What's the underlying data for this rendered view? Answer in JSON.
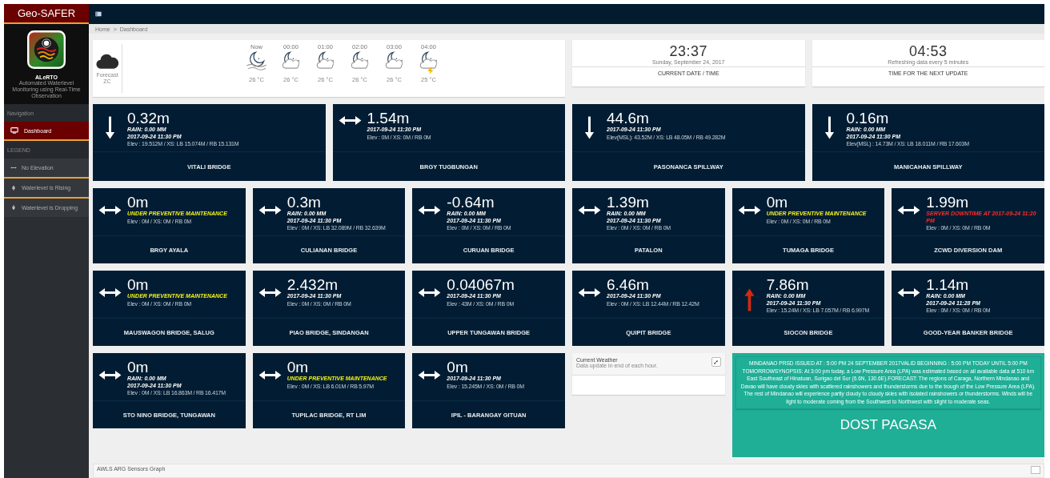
{
  "sidebar": {
    "title": "Geo-SAFER",
    "app_name": "ALeRTO",
    "app_subtitle": "Automated Waterlevel Monitoring using Real-Time Observation",
    "nav_header": "Navigation",
    "nav_items": [
      {
        "label": "Dashboard",
        "selected": true
      }
    ],
    "legend_header": "LEGEND",
    "legend_items": [
      {
        "kind": "steady",
        "label": "No Elevation"
      },
      {
        "kind": "rising",
        "label": "Waterlevel is Rising"
      },
      {
        "kind": "dropping",
        "label": "Waterlevel is Dropping"
      }
    ]
  },
  "breadcrumb": {
    "items": [
      "Home",
      "Dashboard"
    ],
    "separator": ">"
  },
  "forecast": {
    "label": "Forecast",
    "place": "ZC",
    "hours": [
      {
        "time": "Now",
        "kind": "moon-wind",
        "temp": "26 °C"
      },
      {
        "time": "00:00",
        "kind": "moon-cloud",
        "temp": "26 °C"
      },
      {
        "time": "01:00",
        "kind": "moon-cloud",
        "temp": "26 °C"
      },
      {
        "time": "02:00",
        "kind": "moon-cloud",
        "temp": "26 °C"
      },
      {
        "time": "03:00",
        "kind": "moon-cloud",
        "temp": "26 °C"
      },
      {
        "time": "04:00",
        "kind": "moon-storm",
        "temp": "25 °C"
      }
    ]
  },
  "clocks": [
    {
      "time": "23:37",
      "note": "Sunday, September 24, 2017",
      "label": "CURRENT DATE / TIME"
    },
    {
      "time": "04:53",
      "note": "Refreshing data every 5 minutes",
      "label": "TIME FOR THE NEXT UPDATE"
    }
  ],
  "featured_stations": [
    {
      "kind": "dropping",
      "level": "0.32m",
      "lines": [
        {
          "kind": "rain",
          "text": "RAIN: 0.00 MM"
        },
        {
          "kind": "date",
          "text": "2017-09-24 11:30 PM"
        },
        {
          "kind": "elev",
          "text": "Elev : 19.512M / XS: LB 15.074M / RB 15.131M"
        }
      ],
      "name": "VITALI BRIDGE"
    },
    {
      "kind": "steady",
      "level": "1.54m",
      "lines": [
        {
          "kind": "date",
          "text": "2017-09-24 11:30 PM"
        },
        {
          "kind": "elev",
          "text": "Elev : 0M / XS: 0M / RB 0M"
        }
      ],
      "name": "BRGY TUGBUNGAN"
    },
    {
      "kind": "dropping",
      "level": "44.6m",
      "lines": [
        {
          "kind": "date",
          "text": "2017-09-24 11:30 PM"
        },
        {
          "kind": "elev",
          "text": "Elev(MSL): 43.52M / XS: LB 48.05M / RB 49.282M"
        }
      ],
      "name": "PASONANCA SPILLWAY"
    },
    {
      "kind": "dropping",
      "level": "0.16m",
      "lines": [
        {
          "kind": "rain",
          "text": "RAIN: 0.00 MM"
        },
        {
          "kind": "date",
          "text": "2017-09-24 11:30 PM"
        },
        {
          "kind": "elev",
          "text": "Elev(MSL) : 14.73M / XS: LB 18.011M / RB 17.603M"
        }
      ],
      "name": "MANICAHAN SPILLWAY"
    }
  ],
  "stations": [
    {
      "kind": "steady",
      "level": "0m",
      "lines": [
        {
          "kind": "maintenance",
          "text": "UNDER PREVENTIVE MAINTENANCE"
        },
        {
          "kind": "elev",
          "text": "Elev : 0M / XS: 0M / RB 0M"
        }
      ],
      "name": "BRGY AYALA"
    },
    {
      "kind": "steady",
      "level": "0.3m",
      "lines": [
        {
          "kind": "rain",
          "text": "RAIN: 0.00 MM"
        },
        {
          "kind": "date",
          "text": "2017-09-24 11:30 PM"
        },
        {
          "kind": "elev",
          "text": "Elev : 0M / XS: LB 32.089M / RB 32.639M"
        }
      ],
      "name": "CULIANAN BRIDGE"
    },
    {
      "kind": "steady",
      "level": "-0.64m",
      "lines": [
        {
          "kind": "rain",
          "text": "RAIN: 0.00 MM"
        },
        {
          "kind": "date",
          "text": "2017-09-24 11:30 PM"
        },
        {
          "kind": "elev",
          "text": "Elev : 0M / XS: 0M / RB 0M"
        }
      ],
      "name": "CURUAN BRIDGE"
    },
    {
      "kind": "steady",
      "level": "1.39m",
      "lines": [
        {
          "kind": "rain",
          "text": "RAIN: 0.00 MM"
        },
        {
          "kind": "date",
          "text": "2017-09-24 11:30 PM"
        },
        {
          "kind": "elev",
          "text": "Elev : 0M / XS: 0M / RB 0M"
        }
      ],
      "name": "PATALON"
    },
    {
      "kind": "steady",
      "level": "0m",
      "lines": [
        {
          "kind": "maintenance",
          "text": "UNDER PREVENTIVE MAINTENANCE"
        },
        {
          "kind": "elev",
          "text": "Elev : 0M / XS: 0M / RB 0M"
        }
      ],
      "name": "TUMAGA BRIDGE"
    },
    {
      "kind": "steady",
      "level": "1.99m",
      "lines": [
        {
          "kind": "downtime",
          "text": "SERVER DOWNTIME AT 2017-09-24 11:20 PM"
        },
        {
          "kind": "elev",
          "text": "Elev : 0M / XS: 0M / RB 0M"
        }
      ],
      "name": "ZCWD DIVERSION DAM"
    },
    {
      "kind": "steady",
      "level": "0m",
      "lines": [
        {
          "kind": "maintenance",
          "text": "UNDER PREVENTIVE MAINTENANCE"
        },
        {
          "kind": "elev",
          "text": "Elev : 0M / XS: 0M / RB 0M"
        }
      ],
      "name": "MAUSWAGON BRIDGE, SALUG"
    },
    {
      "kind": "steady",
      "level": "2.432m",
      "lines": [
        {
          "kind": "date",
          "text": "2017-09-24 11:30 PM"
        },
        {
          "kind": "elev",
          "text": "Elev : 0M / XS: 0M / RB 0M"
        }
      ],
      "name": "PIAO BRIDGE, SINDANGAN"
    },
    {
      "kind": "steady",
      "level": "0.04067m",
      "lines": [
        {
          "kind": "date",
          "text": "2017-09-24 11:30 PM"
        },
        {
          "kind": "elev",
          "text": "Elev : 43M / XS: 0M / RB 0M"
        }
      ],
      "name": "UPPER TUNGAWAN BRIDGE"
    },
    {
      "kind": "steady",
      "level": "6.46m",
      "lines": [
        {
          "kind": "date",
          "text": "2017-09-24 11:30 PM"
        },
        {
          "kind": "elev",
          "text": "Elev : 0M / XS: LB 12.44M / RB 12.42M"
        }
      ],
      "name": "QUIPIT BRIDGE"
    },
    {
      "kind": "rising",
      "level": "7.86m",
      "lines": [
        {
          "kind": "rain",
          "text": "RAIN: 0.00 MM"
        },
        {
          "kind": "date",
          "text": "2017-09-24 11:30 PM"
        },
        {
          "kind": "elev",
          "text": "Elev : 15.24M / XS: LB 7.057M / RB 6.997M"
        }
      ],
      "name": "SIOCON BRIDGE"
    },
    {
      "kind": "steady",
      "level": "1.14m",
      "lines": [
        {
          "kind": "rain",
          "text": "RAIN: 0.00 MM"
        },
        {
          "kind": "date",
          "text": "2017-09-24 11:28 PM"
        },
        {
          "kind": "elev",
          "text": "Elev : 0M / XS: 0M / RB 0M"
        }
      ],
      "name": "GOOD-YEAR BANKER BRIDGE"
    },
    {
      "kind": "steady",
      "level": "0m",
      "lines": [
        {
          "kind": "rain",
          "text": "RAIN: 0.00 MM"
        },
        {
          "kind": "date",
          "text": "2017-09-24 11:30 PM"
        },
        {
          "kind": "elev",
          "text": "Elev : 0M / XS: LB 16.863M / RB 16.417M"
        }
      ],
      "name": "STO NINO BRIDGE, TUNGAWAN"
    },
    {
      "kind": "steady",
      "level": "0m",
      "lines": [
        {
          "kind": "maintenance",
          "text": "UNDER PREVENTIVE MAINTENANCE"
        },
        {
          "kind": "elev",
          "text": "Elev : 0M / XS: LB 6.01M / RB 5.97M"
        }
      ],
      "name": "TUPILAC BRIDGE, RT LIM"
    },
    {
      "kind": "steady",
      "level": "0m",
      "lines": [
        {
          "kind": "date",
          "text": "2017-09-24 11:30 PM"
        },
        {
          "kind": "elev",
          "text": "Elev : 15.245M / XS: 0M / RB 0M"
        }
      ],
      "name": "IPIL - BARANGAY GITUAN"
    }
  ],
  "current_weather": {
    "title": "Current Weather",
    "subtitle": "Data update in end of each hour."
  },
  "pagasa": {
    "bulletin": "MINDANAO PRSD ISSUED  AT       :  5:00 PM  24 SEPTEMBER 2017VALID BEGINNING :  5:00 PM  TODAY  UNTIL 5:00 PM  TOMORROWSYNOPSIS:  At 3:00 pm today, a Low Pressure Area (LPA) was estimated based on all available data at 510 km East Southeast of Hinatuan, Surigao del Sur (6.6N, 130.6E).FORECAST: The regions of Caraga, Northern Mindanao and Davao will have cloudy skies with scattered rainshowers and thunderstorms due to the trough of the Low Pressure Area (LPA). The rest of Mindanao will experience partly cloudy to cloudy skies with isolated rainshowers or thunderstorms. Winds will be light to moderate coming from the Southwest to Northwest with slight to moderate seas.",
    "source": "DOST PAGASA"
  },
  "graph_panel": {
    "title": "AWLS ARG Sensors Graph"
  }
}
